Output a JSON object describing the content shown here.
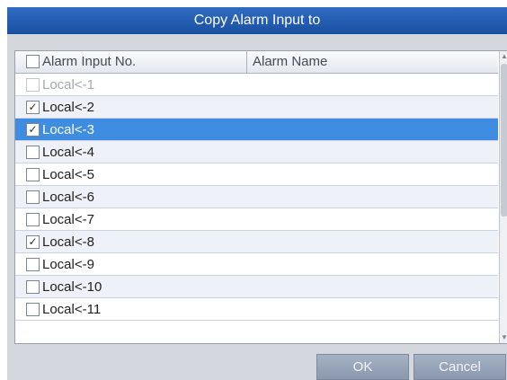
{
  "dialog": {
    "title": "Copy Alarm Input to",
    "columns": {
      "alarm_input_no": "Alarm Input No.",
      "alarm_name": "Alarm Name"
    },
    "select_all_checked": false,
    "rows": [
      {
        "label": "Local<-1",
        "checked": false,
        "disabled": true,
        "selected": false
      },
      {
        "label": "Local<-2",
        "checked": true,
        "disabled": false,
        "selected": false
      },
      {
        "label": "Local<-3",
        "checked": true,
        "disabled": false,
        "selected": true
      },
      {
        "label": "Local<-4",
        "checked": false,
        "disabled": false,
        "selected": false
      },
      {
        "label": "Local<-5",
        "checked": false,
        "disabled": false,
        "selected": false
      },
      {
        "label": "Local<-6",
        "checked": false,
        "disabled": false,
        "selected": false
      },
      {
        "label": "Local<-7",
        "checked": false,
        "disabled": false,
        "selected": false
      },
      {
        "label": "Local<-8",
        "checked": true,
        "disabled": false,
        "selected": false
      },
      {
        "label": "Local<-9",
        "checked": false,
        "disabled": false,
        "selected": false
      },
      {
        "label": "Local<-10",
        "checked": false,
        "disabled": false,
        "selected": false
      },
      {
        "label": "Local<-11",
        "checked": false,
        "disabled": false,
        "selected": false
      }
    ],
    "buttons": {
      "ok": "OK",
      "cancel": "Cancel"
    }
  },
  "colors": {
    "title_bar": "#1f5aad",
    "selection": "#3f8de0",
    "button": "#97a3b8"
  }
}
